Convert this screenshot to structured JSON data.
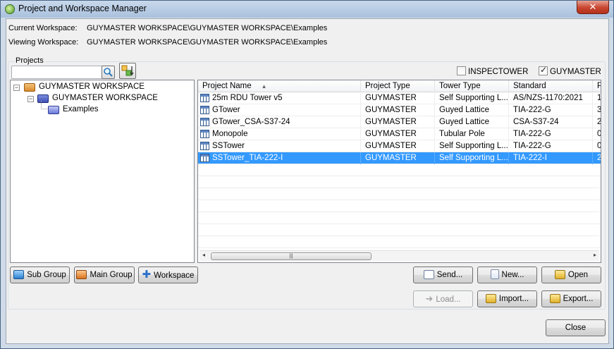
{
  "window": {
    "title": "Project and Workspace Manager",
    "close_glyph": "✕"
  },
  "info": {
    "current_label": "Current Workspace:",
    "current_value": "GUYMASTER WORKSPACE\\GUYMASTER WORKSPACE\\Examples",
    "viewing_label": "Viewing Workspace:",
    "viewing_value": "GUYMASTER WORKSPACE\\GUYMASTER WORKSPACE\\Examples"
  },
  "projects_group": {
    "legend": "Projects",
    "search_value": "",
    "filters": [
      {
        "label": "INSPECTOWER",
        "checked": false
      },
      {
        "label": "GUYMASTER",
        "checked": true
      }
    ]
  },
  "tree": {
    "nodes": [
      {
        "label": "GUYMASTER WORKSPACE",
        "expander": "−"
      },
      {
        "label": "GUYMASTER WORKSPACE",
        "expander": "−"
      },
      {
        "label": "Examples"
      }
    ]
  },
  "list": {
    "columns": [
      "Project Name",
      "Project Type",
      "Tower Type",
      "Standard",
      "P"
    ],
    "sort_glyph": "▲",
    "rows": [
      {
        "name": "25m RDU Tower v5",
        "type": "GUYMASTER",
        "tower": "Self Supporting L...",
        "standard": "AS/NZS-1170:2021",
        "p": "1"
      },
      {
        "name": "GTower",
        "type": "GUYMASTER",
        "tower": "Guyed Lattice",
        "standard": "TIA-222-G",
        "p": "3"
      },
      {
        "name": "GTower_CSA-S37-24",
        "type": "GUYMASTER",
        "tower": "Guyed Lattice",
        "standard": "CSA-S37-24",
        "p": "2"
      },
      {
        "name": "Monopole",
        "type": "GUYMASTER",
        "tower": "Tubular Pole",
        "standard": "TIA-222-G",
        "p": "0"
      },
      {
        "name": "SSTower",
        "type": "GUYMASTER",
        "tower": "Self Supporting L...",
        "standard": "TIA-222-G",
        "p": "0"
      },
      {
        "name": "SSTower_TIA-222-I",
        "type": "GUYMASTER",
        "tower": "Self Supporting L...",
        "standard": "TIA-222-I",
        "p": "2",
        "selected": true
      }
    ],
    "scroll": {
      "left": "◂",
      "right": "▸",
      "grip": "|||"
    }
  },
  "buttons": {
    "sub_group": "Sub Group",
    "main_group": "Main Group",
    "workspace": "Workspace",
    "send": "Send...",
    "new": "New...",
    "open": "Open",
    "load": "Load...",
    "import": "Import...",
    "export": "Export...",
    "close": "Close"
  },
  "colors": {
    "selection": "#3399ff",
    "folder": "#d98a2b"
  }
}
